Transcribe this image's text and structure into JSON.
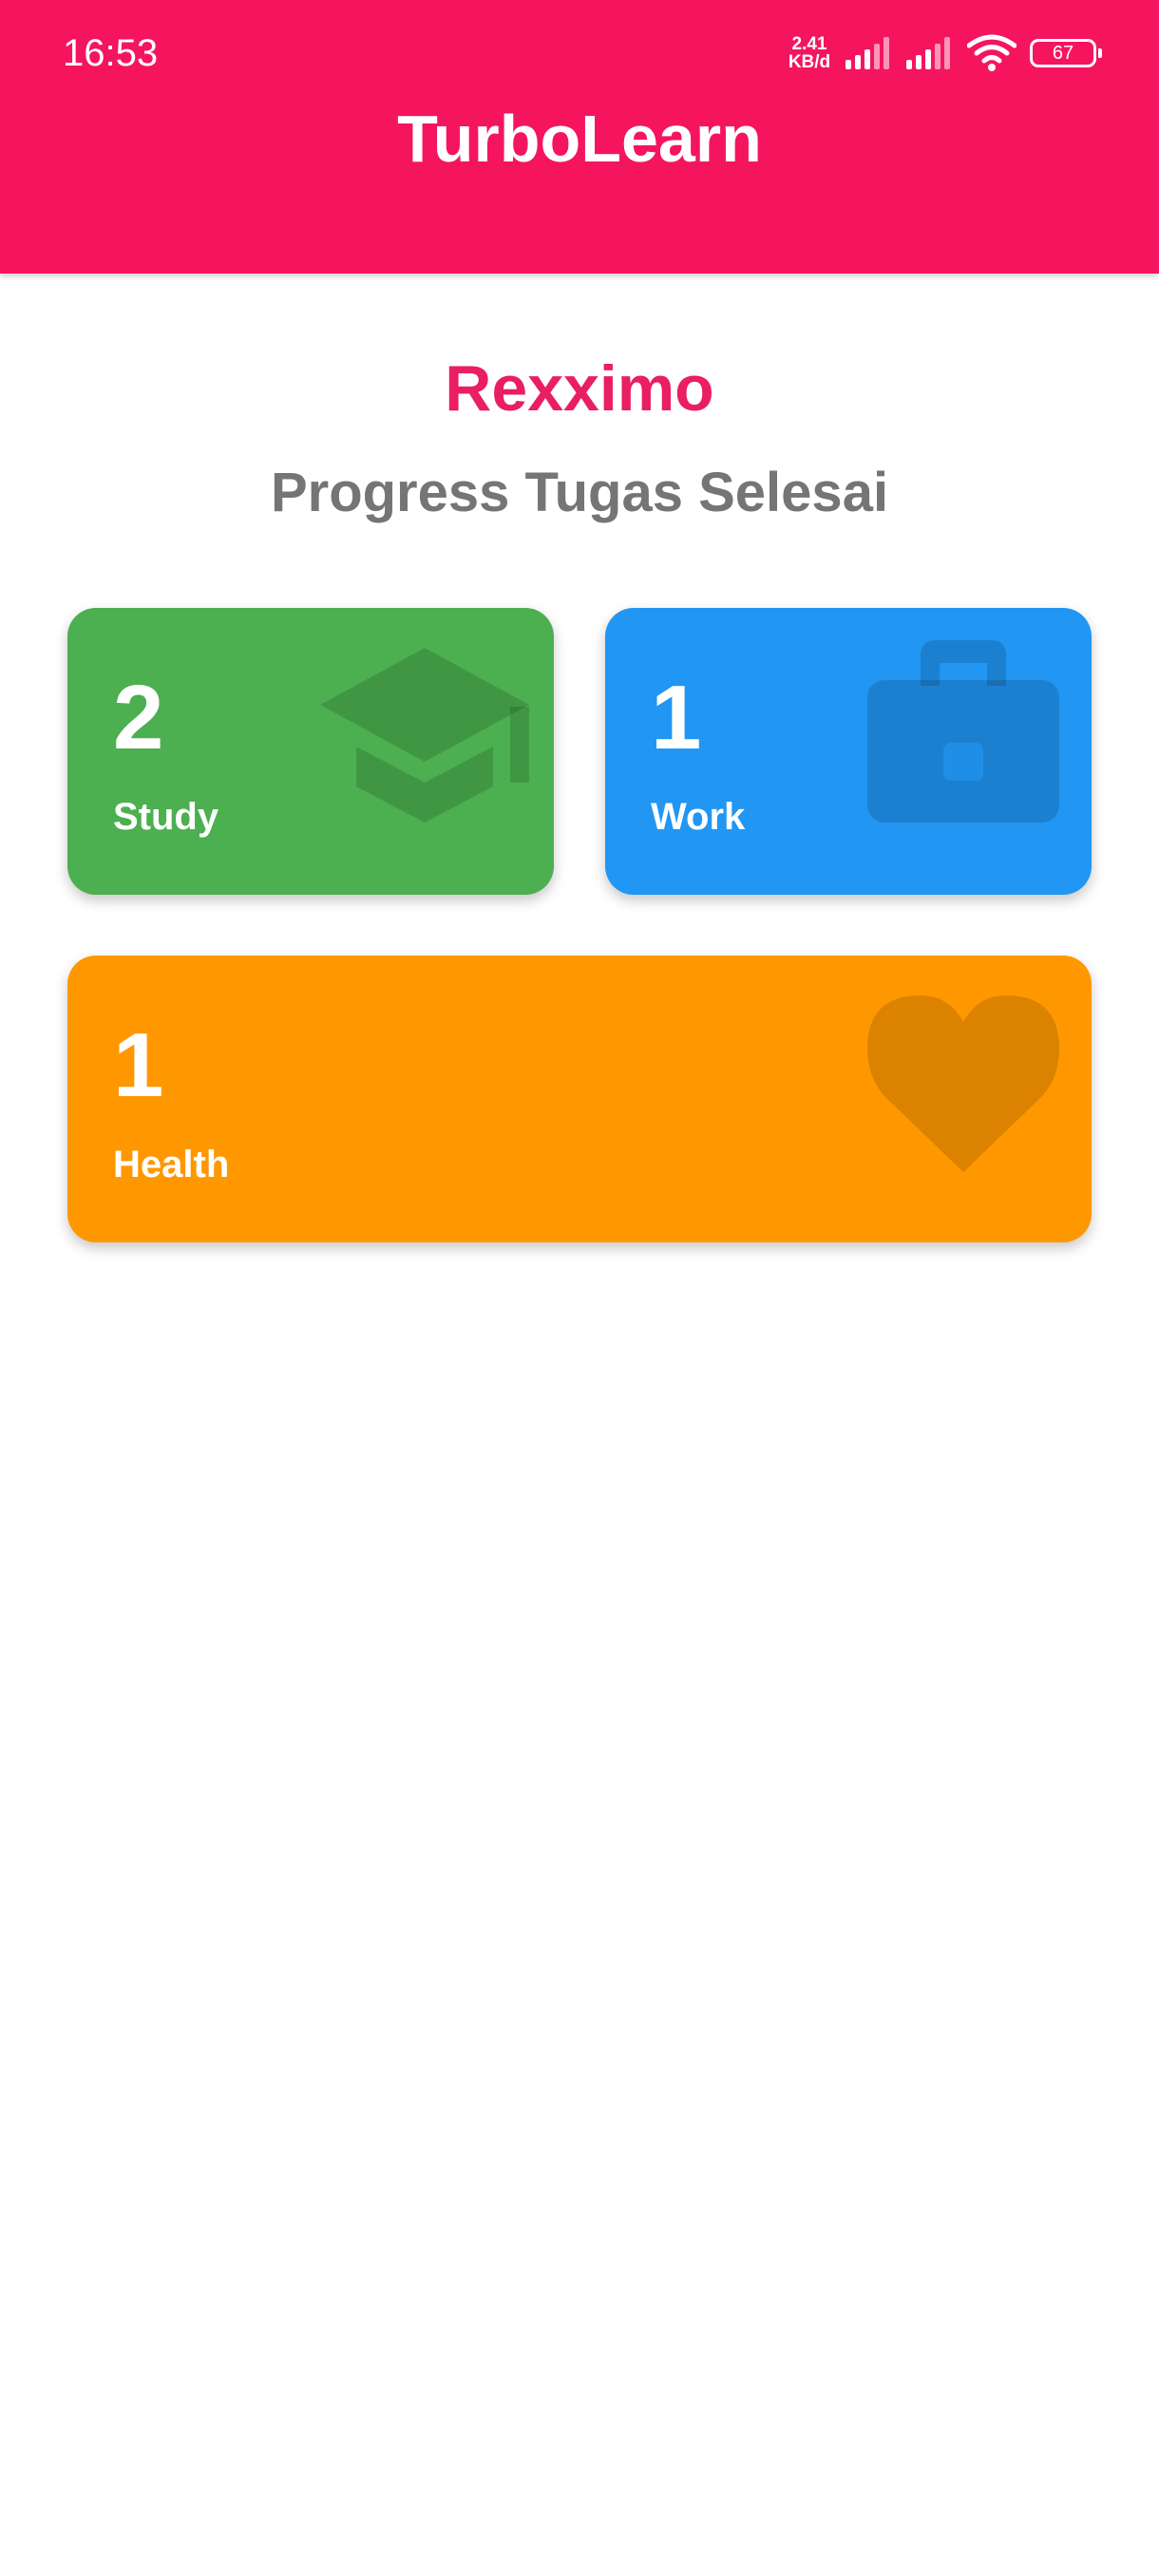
{
  "status_bar": {
    "time": "16:53",
    "net_speed_value": "2.41",
    "net_speed_unit": "KB/d",
    "battery_level": "67",
    "icons": [
      "signal-icon",
      "signal-icon",
      "wifi-icon",
      "battery-icon"
    ]
  },
  "app_bar": {
    "title": "TurboLearn",
    "color": "#F5155F"
  },
  "profile": {
    "name": "Rexximo",
    "name_color": "#E91E63"
  },
  "section": {
    "title": "Progress Tugas Selesai"
  },
  "categories": [
    {
      "count": "2",
      "label": "Study",
      "icon": "graduation-cap-icon",
      "color": "#4CAF50"
    },
    {
      "count": "1",
      "label": "Work",
      "icon": "briefcase-icon",
      "color": "#2196F3"
    },
    {
      "count": "1",
      "label": "Health",
      "icon": "heart-icon",
      "color": "#FF9800"
    }
  ]
}
